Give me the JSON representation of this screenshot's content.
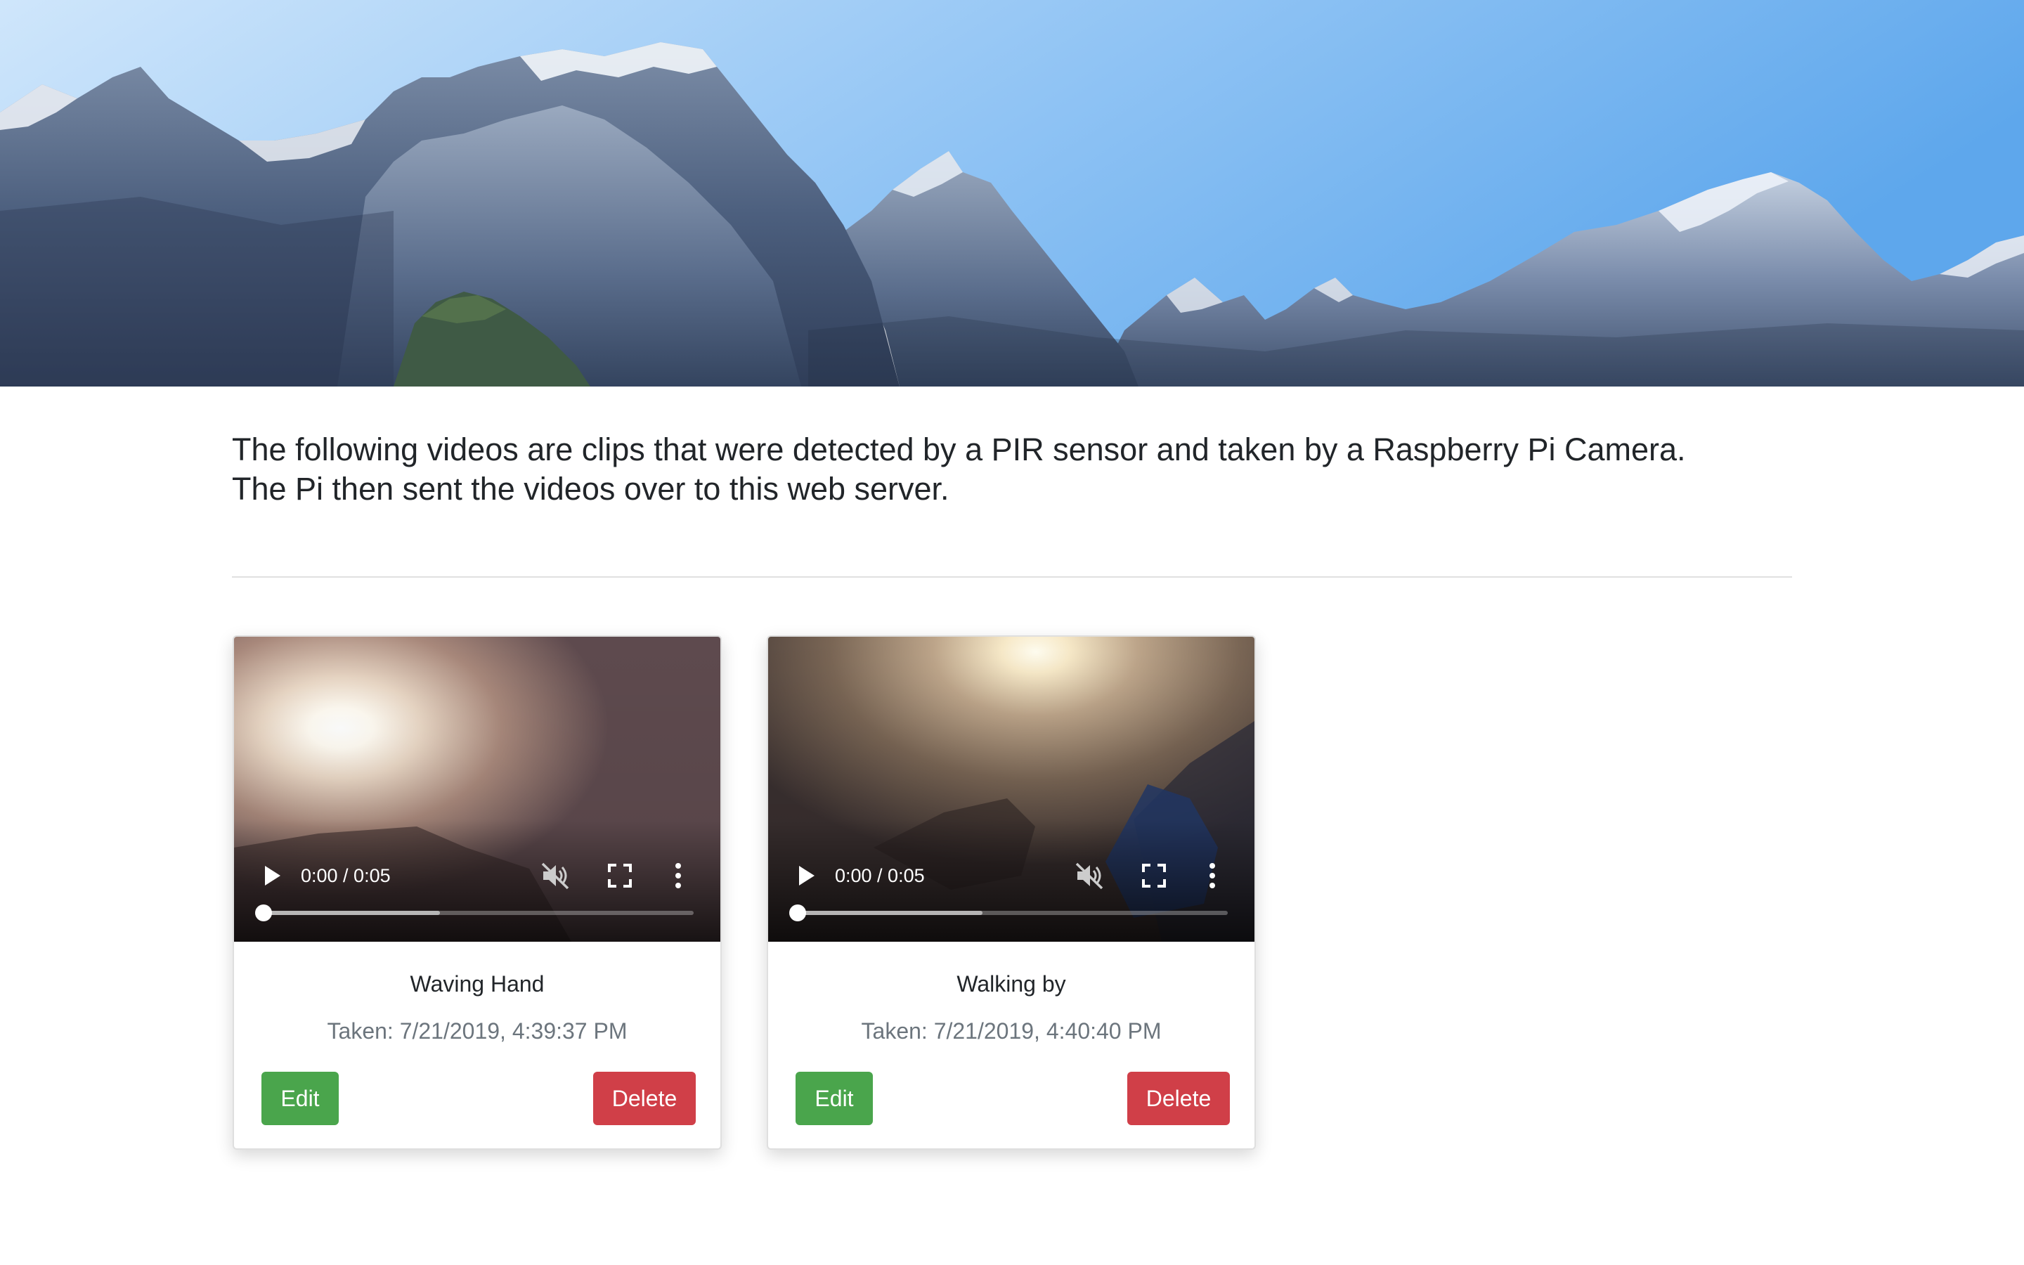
{
  "intro": {
    "line1": "The following videos are clips that were detected by a PIR sensor and taken by a Raspberry Pi Camera.",
    "line2": "The Pi then sent the videos over to this web server."
  },
  "colors": {
    "edit_button": "#4aa54c",
    "delete_button": "#d03f48",
    "sky_top": "#6fb3f0",
    "sky_bottom": "#cfe6fb"
  },
  "videos": [
    {
      "title": "Waving Hand",
      "taken": "Taken: 7/21/2019, 4:39:37 PM",
      "time": "0:00 / 0:05",
      "buffered_fraction": 0.41,
      "played_fraction": 0.0,
      "edit_label": "Edit",
      "delete_label": "Delete",
      "icons": [
        "play-icon",
        "muted-volume-icon",
        "fullscreen-icon",
        "more-options-icon"
      ]
    },
    {
      "title": "Walking by",
      "taken": "Taken: 7/21/2019, 4:40:40 PM",
      "time": "0:00 / 0:05",
      "buffered_fraction": 0.43,
      "played_fraction": 0.0,
      "edit_label": "Edit",
      "delete_label": "Delete",
      "icons": [
        "play-icon",
        "muted-volume-icon",
        "fullscreen-icon",
        "more-options-icon"
      ]
    }
  ]
}
